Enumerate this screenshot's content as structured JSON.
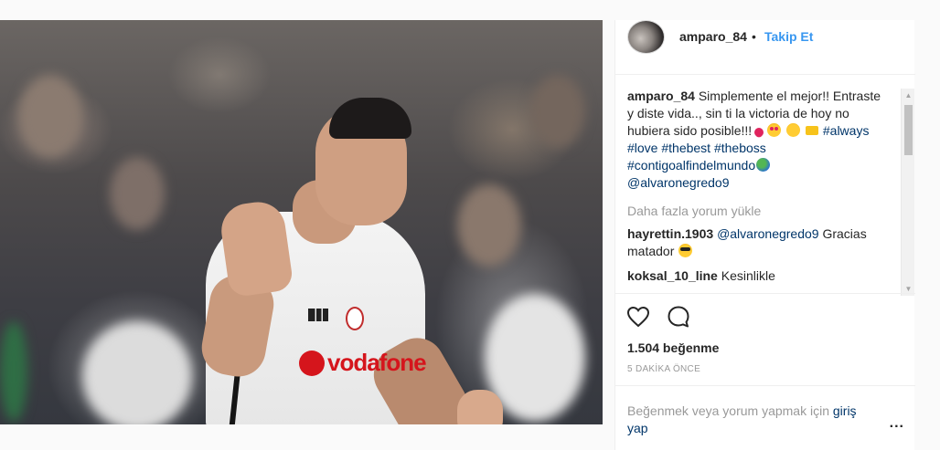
{
  "header": {
    "username": "amparo_84",
    "separator": "•",
    "follow_label": "Takip Et"
  },
  "caption": {
    "username": "amparo_84",
    "text": "Simplemente el mejor!! Entraste y diste vida.., sin ti la victoria de hoy no hubiera sido posible!!!",
    "hashtags_line1": "#always",
    "hashtags_line2": "#love #thebest #theboss",
    "hashtags_line3": "#contigoalfindelmundo",
    "mention": "@alvaronegredo9"
  },
  "load_more_label": "Daha fazla yorum yükle",
  "comments": [
    {
      "username": "hayrettin.1903",
      "mention": "@alvaronegredo9",
      "text": "Gracias matador"
    },
    {
      "username": "koksal_10_line",
      "text": "Kesinlikle"
    }
  ],
  "likes_label": "1.504 beğenme",
  "timestamp": "5 DAKİKA ÖNCE",
  "footer": {
    "prompt": "Beğenmek veya yorum yapmak için",
    "login_link": "giriş yap",
    "more_label": "..."
  },
  "icons": {
    "like": "heart-icon",
    "comment": "comment-icon",
    "more": "more-options-icon",
    "scroll_up": "scroll-up-arrow",
    "scroll_down": "scroll-down-arrow"
  },
  "colors": {
    "accent_link": "#3897f0",
    "hashtag": "#003569",
    "muted": "#999999",
    "text": "#262626"
  },
  "photo": {
    "sponsor_text": "vodafone"
  }
}
